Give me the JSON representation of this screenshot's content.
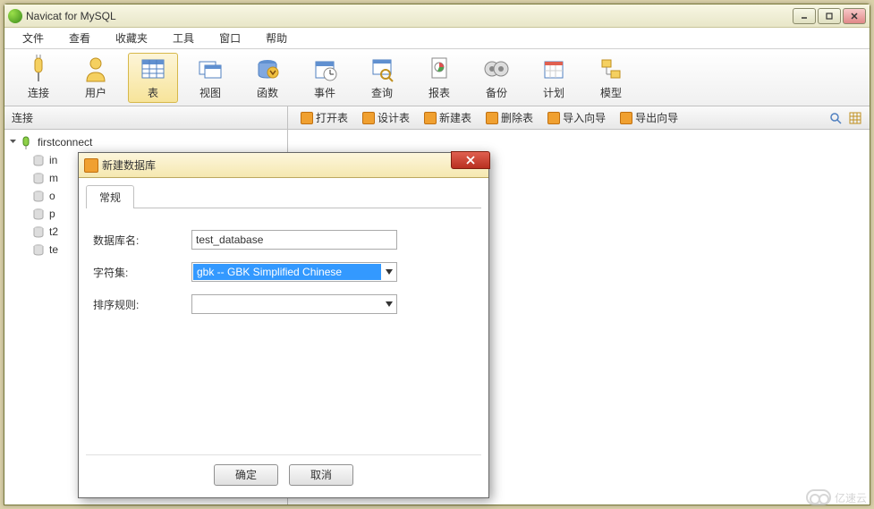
{
  "window": {
    "title": "Navicat for MySQL"
  },
  "menubar": [
    "文件",
    "查看",
    "收藏夹",
    "工具",
    "窗口",
    "帮助"
  ],
  "toolbar": [
    {
      "label": "连接",
      "icon": "plug"
    },
    {
      "label": "用户",
      "icon": "user"
    },
    {
      "label": "表",
      "icon": "table",
      "active": true
    },
    {
      "label": "视图",
      "icon": "view"
    },
    {
      "label": "函数",
      "icon": "function"
    },
    {
      "label": "事件",
      "icon": "event"
    },
    {
      "label": "查询",
      "icon": "query"
    },
    {
      "label": "报表",
      "icon": "report"
    },
    {
      "label": "备份",
      "icon": "backup"
    },
    {
      "label": "计划",
      "icon": "schedule"
    },
    {
      "label": "模型",
      "icon": "model"
    }
  ],
  "subtoolbar": {
    "left_label": "连接",
    "actions": [
      "打开表",
      "设计表",
      "新建表",
      "删除表",
      "导入向导",
      "导出向导"
    ]
  },
  "tree": {
    "root": "firstconnect",
    "children": [
      "in",
      "m",
      "o",
      "p",
      "t2",
      "te"
    ]
  },
  "dialog": {
    "title": "新建数据库",
    "tab": "常规",
    "fields": {
      "db_name_label": "数据库名:",
      "db_name_value": "test_database",
      "charset_label": "字符集:",
      "charset_value": "gbk -- GBK Simplified Chinese",
      "collation_label": "排序规则:",
      "collation_value": ""
    },
    "buttons": {
      "ok": "确定",
      "cancel": "取消"
    }
  },
  "watermark": "亿速云"
}
